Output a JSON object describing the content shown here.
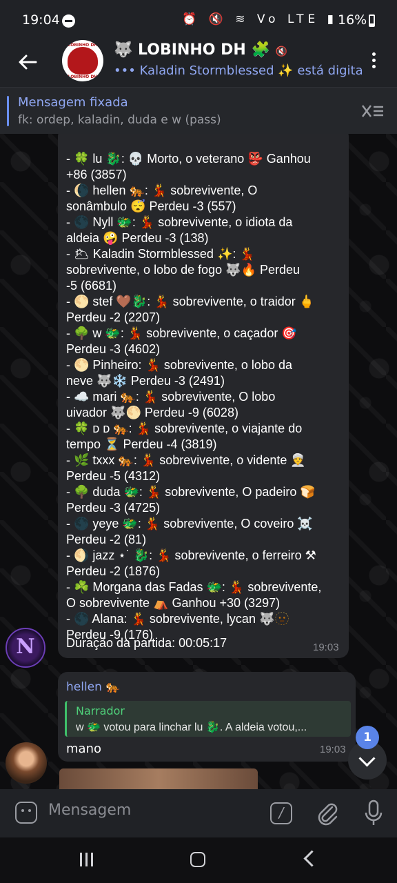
{
  "status_bar": {
    "time": "19:04",
    "battery": "16%",
    "icons": "⏰ 🔇 ≋ Vo LTE ▮"
  },
  "header": {
    "title": "🐺 LOBINHO DH 🧩",
    "mute_icon": "🔇",
    "typing": "••• Kaladin Stormblessed ✨ está digita",
    "avatar_text_top": "LOBINHO DH",
    "avatar_text_bottom": "LOBINHO DH"
  },
  "pinned": {
    "title": "Mensagem fixada",
    "text": "fk: ordep, kaladin, duda e w (pass)"
  },
  "message1": {
    "lines": [
      "",
      "- 🍀 lu 🐉: 💀 Morto, o veterano 👺 Ganhou",
      "+86 (3857)",
      "- 🌘 hellen 🐅: 💃 sobrevivente, O",
      "sonâmbulo 😴 Perdeu -3 (557)",
      "- 🌑 Nyll 🐲: 💃 sobrevivente,  o idiota da",
      "aldeia 🤪  Perdeu -3 (138)",
      "- 🌥 Kaladin Stormblessed ✨: 💃",
      "sobrevivente,  o lobo de fogo 🐺🔥  Perdeu",
      "-5 (6681)",
      "- 🌕 stef 🤎🐉: 💃 sobrevivente, o traidor 🖕",
      "Perdeu -2 (2207)",
      "- 🌳 w 🐲: 💃 sobrevivente, o caçador 🎯",
      "Perdeu -3 (4602)",
      "- 🌕 Pinheiro: 💃 sobrevivente, o lobo da",
      "neve 🐺❄️ Perdeu -3 (2491)",
      "- ☁️ mari 🐅: 💃 sobrevivente, O lobo",
      "uivador 🐺🌕 Perdeu -9 (6028)",
      "- 🍀 ᴅ ᴅ 🐅: 💃 sobrevivente,  o viajante do",
      "tempo ⏳  Perdeu -4 (3819)",
      "- 🌿 txxx 🐅: 💃 sobrevivente, o vidente 👳",
      "Perdeu -5 (4312)",
      "- 🌳 duda 🐲: 💃 sobrevivente, O padeiro 🍞",
      "Perdeu -3 (4725)",
      "- 🌑 yeye 🐲: 💃 sobrevivente, O coveiro ☠️",
      "Perdeu -2 (81)",
      "- 🌖 jazz ⋆˙ 🐉: 💃 sobrevivente, o ferreiro ⚒",
      "Perdeu -2 (1876)",
      "- ☘️ Morgana das Fadas 🐲: 💃 sobrevivente,",
      "O sobrevivente ⛺ Ganhou +30 (3297)",
      "- 🌑 Alana: 💃 sobrevivente, lycan 🐺🫥",
      "Perdeu -9 (176)"
    ],
    "duration": "Duração da partida: 00:05:17",
    "time": "19:03"
  },
  "avatar_n": "N",
  "message2": {
    "sender": "hellen 🐅",
    "reply_name": "Narrador",
    "reply_text": "w 🐲 votou para linchar lu 🐉.  A aldeia votou,...",
    "text": "mano",
    "time": "19:03"
  },
  "scroll_badge": "1",
  "input": {
    "placeholder": "Mensagem"
  }
}
